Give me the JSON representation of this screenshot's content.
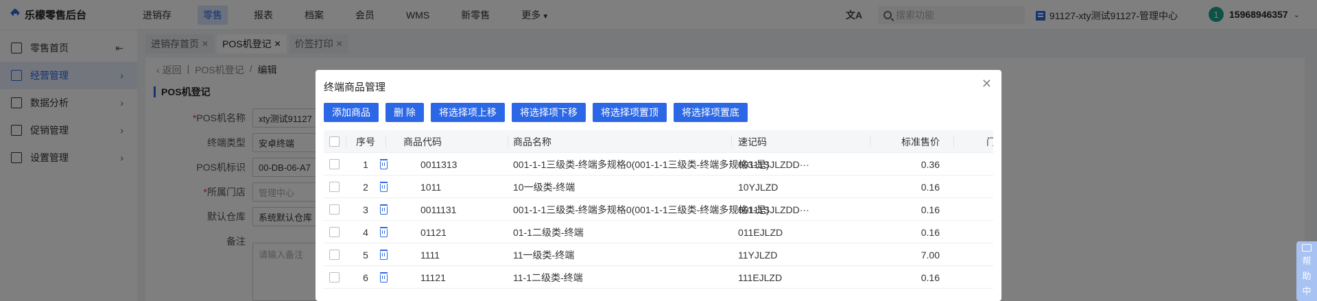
{
  "app": {
    "logo_text": "乐檬零售后台"
  },
  "nav": {
    "items": [
      "进销存",
      "零售",
      "报表",
      "档案",
      "会员",
      "WMS",
      "新零售",
      "更多"
    ],
    "active_index": 1
  },
  "header": {
    "translate_icon": "文A",
    "search_placeholder": "搜索功能",
    "store": "91127-xty测试91127-管理中心",
    "avatar_text": "1",
    "user": "15968946357"
  },
  "sidebar": {
    "items": [
      {
        "label": "零售首页",
        "icon": "home-icon"
      },
      {
        "label": "经营管理",
        "icon": "dashboard-icon"
      },
      {
        "label": "数据分析",
        "icon": "chart-icon"
      },
      {
        "label": "促销管理",
        "icon": "promotion-icon"
      },
      {
        "label": "设置管理",
        "icon": "settings-icon"
      }
    ],
    "active_index": 1
  },
  "tabs": [
    {
      "label": "进销存首页"
    },
    {
      "label": "POS机登记"
    },
    {
      "label": "价签打印"
    }
  ],
  "breadcrumb": {
    "back": "返回",
    "parent": "POS机登记",
    "current": "编辑"
  },
  "form": {
    "section_title": "POS机登记",
    "fields": [
      {
        "label": "POS机名称",
        "value": "xty测试91127",
        "required": true
      },
      {
        "label": "终端类型",
        "value": "安卓终端",
        "required": false
      },
      {
        "label": "POS机标识",
        "value": "00-DB-06-A7",
        "required": false
      },
      {
        "label": "所属门店",
        "value": "管理中心",
        "required": true
      },
      {
        "label": "默认仓库",
        "value": "系统默认仓库",
        "required": false
      }
    ],
    "remark_label": "备注",
    "remark_placeholder": "请输入备注"
  },
  "modal": {
    "title": "终端商品管理",
    "buttons": [
      "添加商品",
      "删 除",
      "将选择项上移",
      "将选择项下移",
      "将选择项置顶",
      "将选择项置底"
    ],
    "columns": [
      "序号",
      "商品代码",
      "商品名称",
      "速记码",
      "标准售价",
      "门"
    ],
    "rows": [
      {
        "seq": "1",
        "code": "0011313",
        "name": "001-1-1三级类-终端多规格0(001-1-1三级类-终端多规格3-是)",
        "mnemonic": "00111SJLZDD···",
        "price": "0.36"
      },
      {
        "seq": "2",
        "code": "1011",
        "name": "10一级类-终端",
        "mnemonic": "10YJLZD",
        "price": "0.16"
      },
      {
        "seq": "3",
        "code": "0011131",
        "name": "001-1-1三级类-终端多规格0(001-1-1三级类-终端多规格1-是)",
        "mnemonic": "00111SJLZDD···",
        "price": "0.16"
      },
      {
        "seq": "4",
        "code": "01121",
        "name": "01-1二级类-终端",
        "mnemonic": "011EJLZD",
        "price": "0.16"
      },
      {
        "seq": "5",
        "code": "1111",
        "name": "11一级类-终端",
        "mnemonic": "11YJLZD",
        "price": "7.00"
      },
      {
        "seq": "6",
        "code": "11121",
        "name": "11-1二级类-终端",
        "mnemonic": "111EJLZD",
        "price": "0.16"
      }
    ]
  },
  "help": {
    "chars": [
      "帮",
      "助",
      "中"
    ]
  },
  "colors": {
    "primary": "#2c68e6",
    "active_bg": "#e7edf9"
  }
}
